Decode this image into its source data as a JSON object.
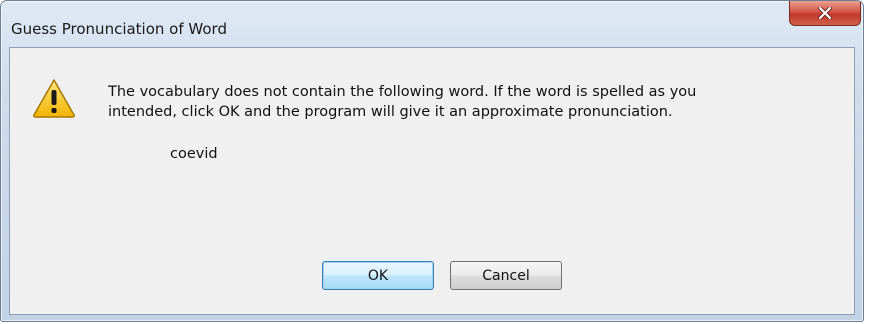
{
  "dialog": {
    "title": "Guess Pronunciation of Word",
    "message": "The vocabulary does not contain the following word. If the word is spelled as you\nintended, click OK and the program will give it an approximate pronunciation.",
    "word": "coevid",
    "ok_label": "OK",
    "cancel_label": "Cancel",
    "icon": "warning-icon",
    "close_icon": "close-icon"
  },
  "colors": {
    "close_button": "#c94a3a",
    "frame": "#c9d7e8",
    "client_bg": "#f0f0f0",
    "default_button_border": "#3c7fb1"
  }
}
